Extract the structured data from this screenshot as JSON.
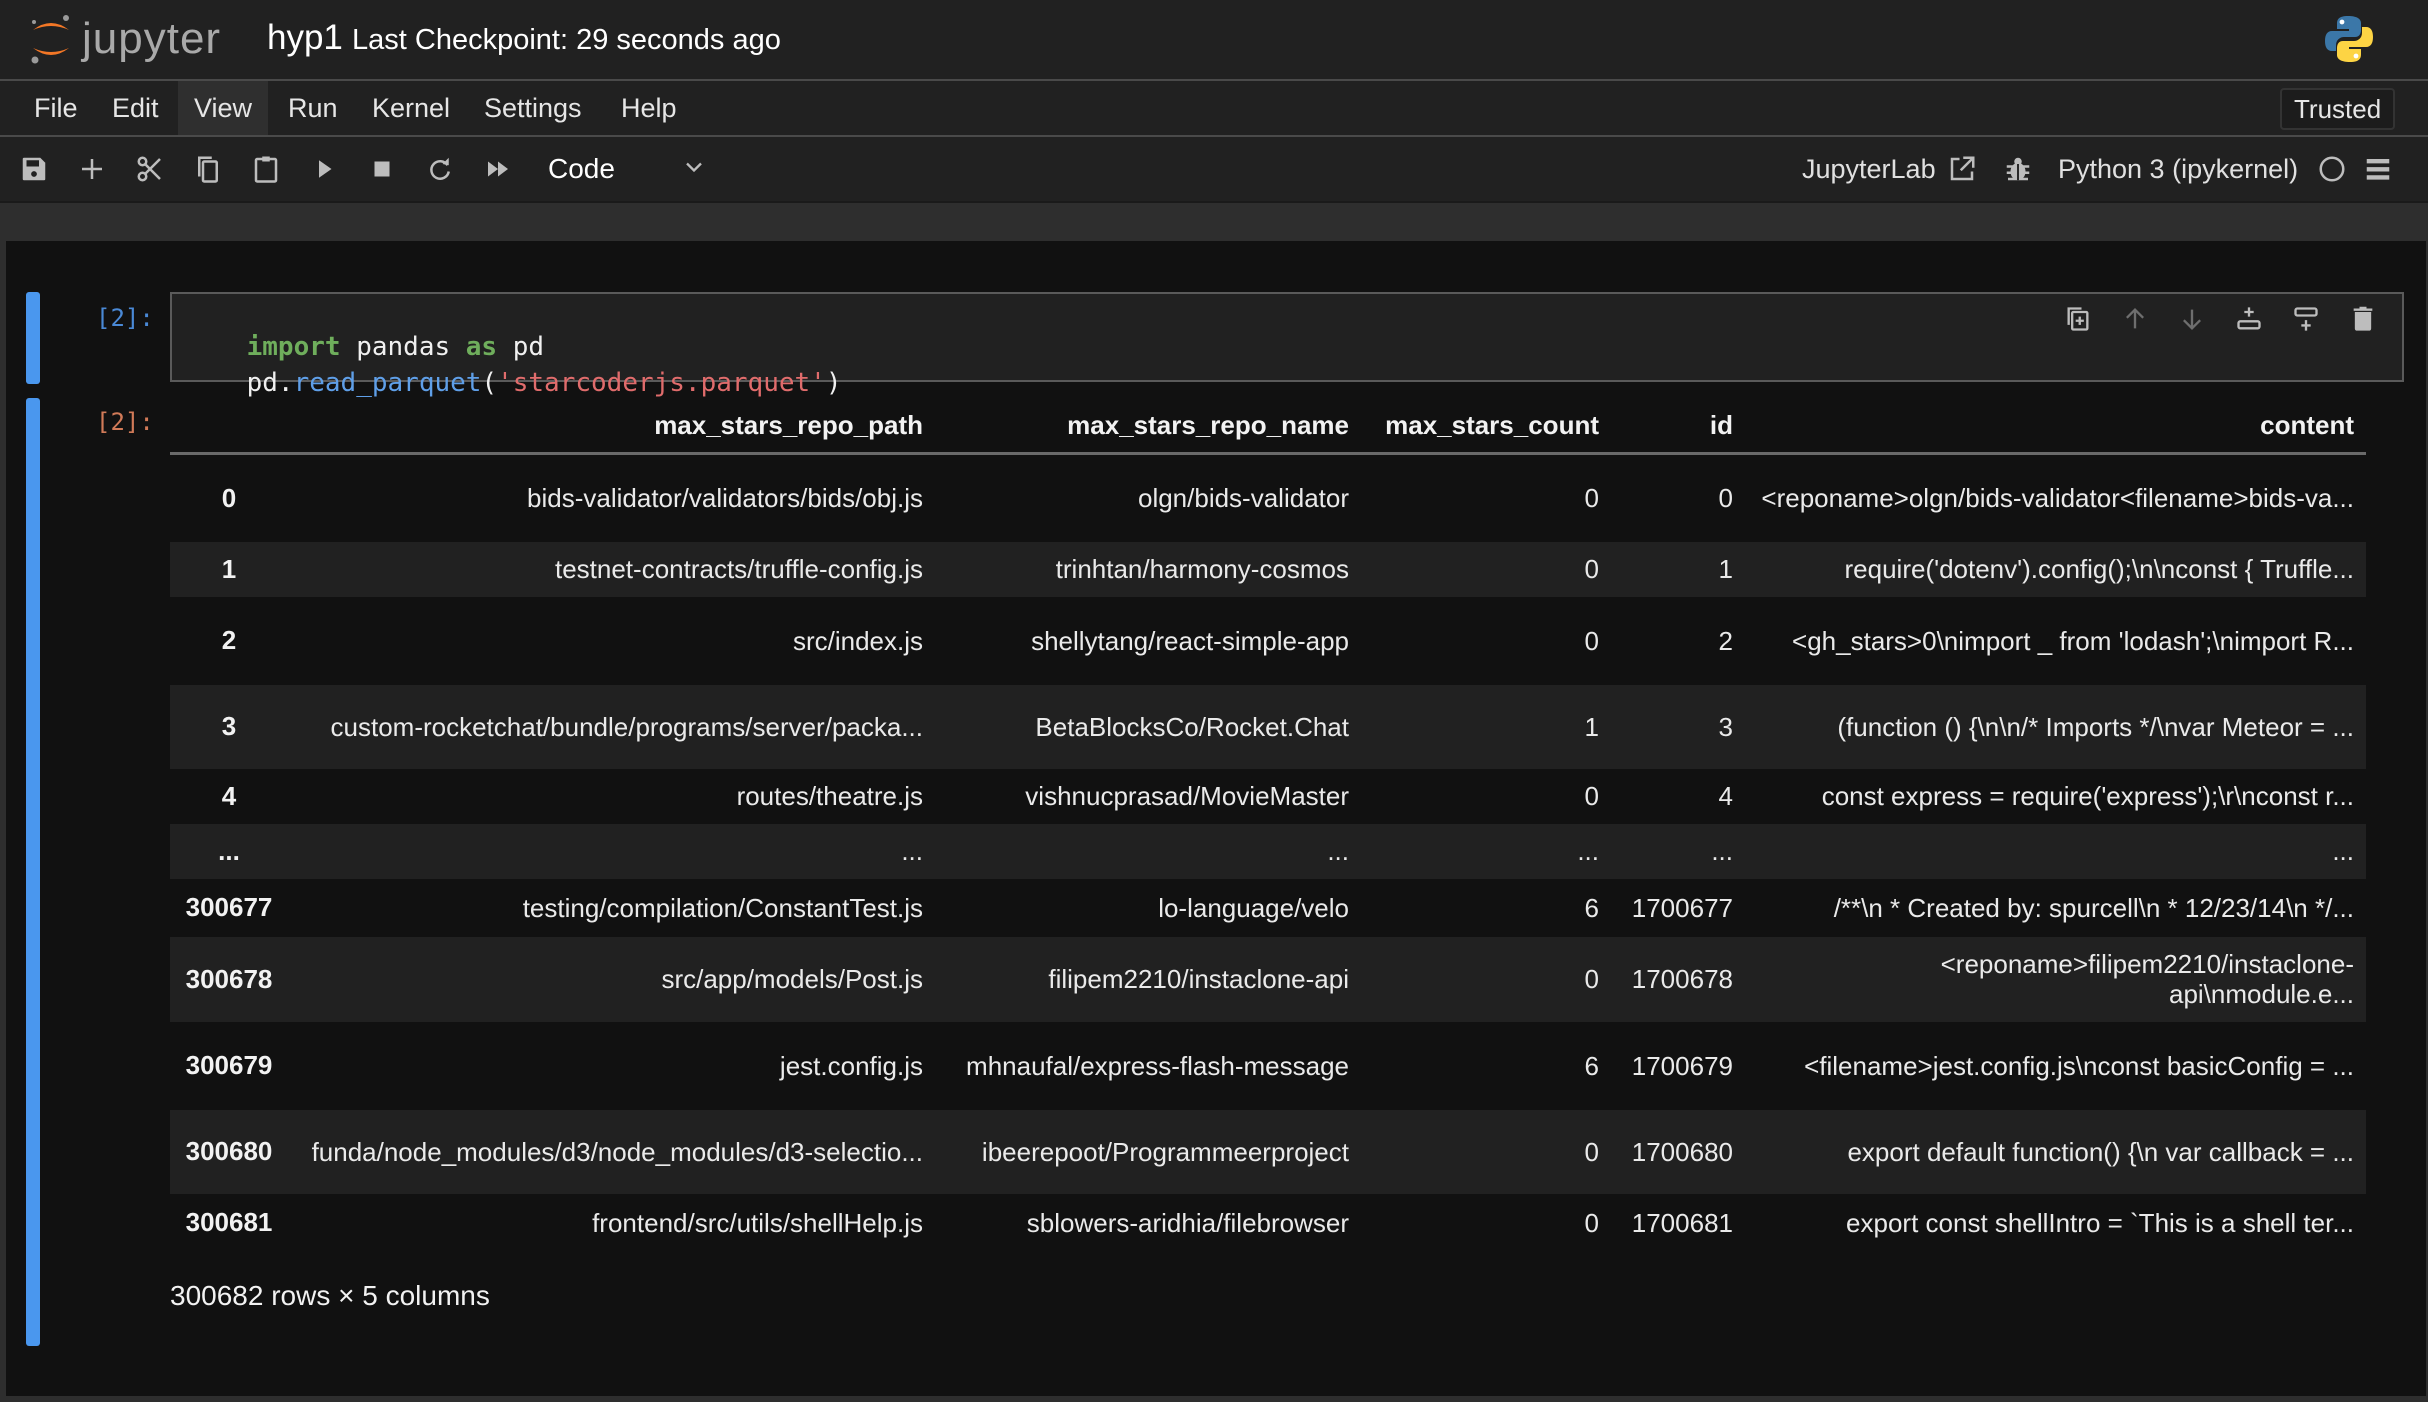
{
  "header": {
    "app_name": "jupyter",
    "notebook_title": "hyp1",
    "checkpoint_status": "Last Checkpoint: 29 seconds ago"
  },
  "menu": {
    "items": [
      "File",
      "Edit",
      "View",
      "Run",
      "Kernel",
      "Settings",
      "Help"
    ],
    "active": "View",
    "trusted_label": "Trusted"
  },
  "toolbar": {
    "icons": [
      "save-icon",
      "add-cell-icon",
      "cut-icon",
      "copy-icon",
      "paste-icon",
      "run-icon",
      "stop-icon",
      "restart-icon",
      "run-all-icon"
    ],
    "cell_type": "Code",
    "jupyterlab_label": "JupyterLab",
    "kernel_name": "Python 3 (ipykernel)"
  },
  "input_cell": {
    "prompt": "[2]:",
    "code_lines": [
      [
        {
          "t": "import",
          "c": "kw"
        },
        {
          "t": " pandas ",
          "c": ""
        },
        {
          "t": "as",
          "c": "kw"
        },
        {
          "t": " pd",
          "c": ""
        }
      ],
      [
        {
          "t": "pd.",
          "c": ""
        },
        {
          "t": "read_parquet",
          "c": "fn"
        },
        {
          "t": "(",
          "c": ""
        },
        {
          "t": "'starcoderjs.parquet'",
          "c": "str"
        },
        {
          "t": ")",
          "c": ""
        }
      ]
    ]
  },
  "output_cell": {
    "prompt": "[2]:",
    "columns": [
      "",
      "max_stars_repo_path",
      "max_stars_repo_name",
      "max_stars_count",
      "id",
      "content"
    ],
    "rows": [
      [
        "0",
        "bids-validator/validators/bids/obj.js",
        "olgn/bids-validator",
        "0",
        "0",
        "<reponame>olgn/bids-validator<filename>bids-va..."
      ],
      [
        "1",
        "testnet-contracts/truffle-config.js",
        "trinhtan/harmony-cosmos",
        "0",
        "1",
        "require('dotenv').config();\\n\\nconst { Truffle..."
      ],
      [
        "2",
        "src/index.js",
        "shellytang/react-simple-app",
        "0",
        "2",
        "<gh_stars>0\\nimport _ from 'lodash';\\nimport R..."
      ],
      [
        "3",
        "custom-rocketchat/bundle/programs/server/packa...",
        "BetaBlocksCo/Rocket.Chat",
        "1",
        "3",
        "(function () {\\n\\n/* Imports */\\nvar Meteor = ..."
      ],
      [
        "4",
        "routes/theatre.js",
        "vishnucprasad/MovieMaster",
        "0",
        "4",
        "const express = require('express');\\r\\nconst r..."
      ],
      [
        "...",
        "...",
        "...",
        "...",
        "...",
        "..."
      ],
      [
        "300677",
        "testing/compilation/ConstantTest.js",
        "lo-language/velo",
        "6",
        "1700677",
        "/**\\n * Created by: spurcell\\n * 12/23/14\\n */..."
      ],
      [
        "300678",
        "src/app/models/Post.js",
        "filipem2210/instaclone-api",
        "0",
        "1700678",
        "<reponame>filipem2210/instaclone-api\\nmodule.e..."
      ],
      [
        "300679",
        "jest.config.js",
        "mhnaufal/express-flash-message",
        "6",
        "1700679",
        "<filename>jest.config.js\\nconst basicConfig = ..."
      ],
      [
        "300680",
        "funda/node_modules/d3/node_modules/d3-selectio...",
        "ibeerepoot/Programmeerproject",
        "0",
        "1700680",
        "export default function() {\\n var callback = ..."
      ],
      [
        "300681",
        "frontend/src/utils/shellHelp.js",
        "sblowers-aridhia/filebrowser",
        "0",
        "1700681",
        "export const shellIntro = `This is a shell ter..."
      ]
    ],
    "shape_summary": "300682 rows × 5 columns"
  },
  "colors": {
    "accent": "#4a97ee",
    "in_prompt": "#4a89d6",
    "out_prompt": "#d17a58",
    "keyword": "#6fae5c",
    "function": "#5f9fe8",
    "string": "#e06c6c",
    "jupyter_orange": "#f37726"
  }
}
